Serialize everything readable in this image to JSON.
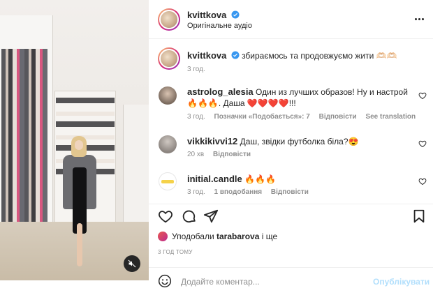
{
  "post": {
    "author": "kvittkova",
    "audio": "Оригінальне аудіо",
    "caption_text": "збираємось та продовжуємо жити 🫶🏻🫶🏻",
    "caption_time": "3 год."
  },
  "comments": [
    {
      "username": "astrolog_alesia",
      "text": "Один из лучших образов! Ну и настрой 🔥🔥🔥. Даша ❤️❤️❤️❤️!!!",
      "time": "3 год.",
      "likes": "Позначки «Подобається»: 7",
      "reply": "Відповісти",
      "translate": "See translation"
    },
    {
      "username": "vikkikivvi12",
      "text": "Даш, звідки футболка біла?😍",
      "time": "20 хв",
      "reply": "Відповісти"
    },
    {
      "username": "initial.candle",
      "text": "🔥🔥🔥",
      "time": "3 год.",
      "likes": "1 вподобання",
      "reply": "Відповісти"
    }
  ],
  "likes_line": {
    "prefix": "Уподобали",
    "user": "tarabarova",
    "suffix": "і ще"
  },
  "timestamp": "3 ГОД ТОМУ",
  "composer": {
    "placeholder": "Додайте коментар...",
    "post_label": "Опублікувати"
  },
  "icons": {
    "verified": "verified-badge-icon",
    "more": "more-options-icon",
    "like": "heart-icon",
    "comment": "comment-bubble-icon",
    "share": "paper-plane-icon",
    "save": "bookmark-icon",
    "emoji": "emoji-smile-icon",
    "mute": "speaker-muted-icon"
  },
  "colors": {
    "verified": "#3897f0",
    "post_button_disabled": "#b2dffc",
    "secondary_text": "#8e8e8e"
  }
}
